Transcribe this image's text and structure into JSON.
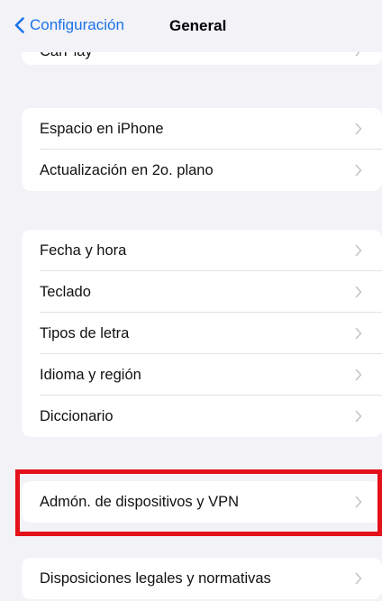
{
  "navbar": {
    "back_label": "Configuración",
    "title": "General"
  },
  "clipped_item": {
    "label": "CarPlay"
  },
  "groups": [
    {
      "items": [
        {
          "label": "Espacio en iPhone"
        },
        {
          "label": "Actualización en 2o. plano"
        }
      ]
    },
    {
      "items": [
        {
          "label": "Fecha y hora"
        },
        {
          "label": "Teclado"
        },
        {
          "label": "Tipos de letra"
        },
        {
          "label": "Idioma y región"
        },
        {
          "label": "Diccionario"
        }
      ]
    },
    {
      "items": [
        {
          "label": "Admón. de dispositivos y VPN"
        }
      ]
    },
    {
      "items": [
        {
          "label": "Disposiciones legales y normativas"
        }
      ]
    }
  ],
  "colors": {
    "accent": "#1a73e8",
    "background": "#f2f2f7",
    "highlight": "#e4101a",
    "chevron": "#c4c4c7"
  }
}
